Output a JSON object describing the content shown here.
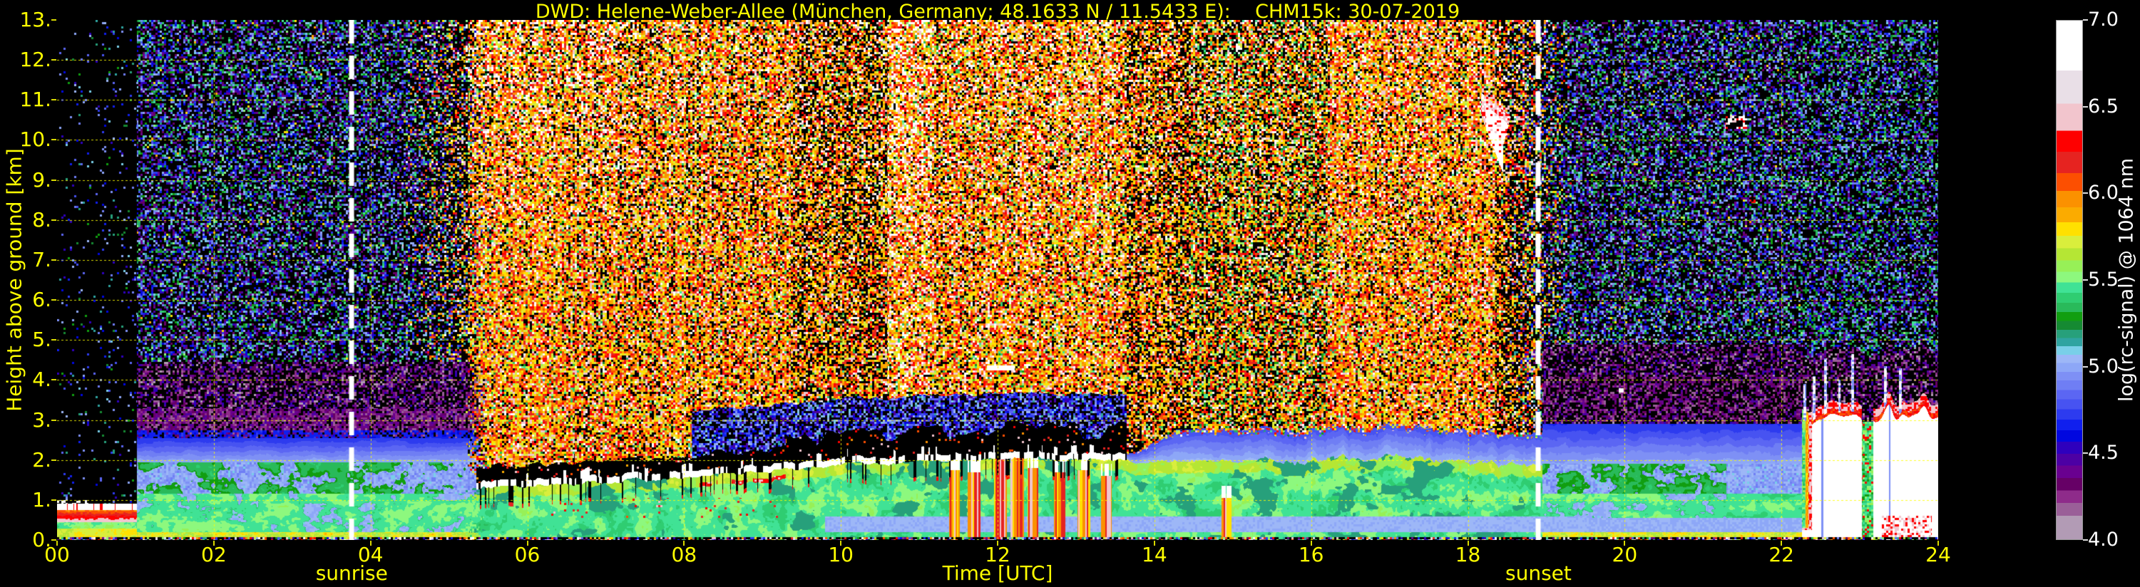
{
  "title": "DWD: Helene-Weber-Allee (München, Germany; 48.1633 N / 11.5433 E):    CHM15k: 30-07-2019",
  "axes": {
    "x": {
      "label": "Time [UTC]",
      "ticks": [
        "00",
        "02",
        "04",
        "06",
        "08",
        "10",
        "12",
        "14",
        "16",
        "18",
        "20",
        "22",
        "24"
      ]
    },
    "y": {
      "label": "Height above ground [km]",
      "ticks": [
        "0.",
        "1.",
        "2.",
        "3.",
        "4.",
        "5.",
        "6.",
        "7.",
        "8.",
        "9.",
        "10.",
        "11.",
        "12.",
        "13."
      ]
    }
  },
  "annotations": {
    "sunrise": {
      "label": "sunrise",
      "hour": 3.76
    },
    "sunset": {
      "label": "sunset",
      "hour": 18.9
    }
  },
  "colors": {
    "background": "#000000",
    "axis_text": "#ffff00",
    "grid": "#ffff00",
    "sun_line": "#ffffff",
    "colorbar_text": "#ffffff"
  },
  "colorbar": {
    "label": "log(rc-signal) @ 1064 nm",
    "ticks": [
      "7.0",
      "6.5",
      "6.0",
      "5.5",
      "5.0",
      "4.5",
      "4.0"
    ],
    "range": [
      4.0,
      7.0
    ],
    "bands": [
      {
        "stop": 0.0,
        "color": "#ffffff"
      },
      {
        "stop": 0.096,
        "color": "#e9dfe7"
      },
      {
        "stop": 0.16,
        "color": "#f2c5cd"
      },
      {
        "stop": 0.212,
        "color": "#fe0000"
      },
      {
        "stop": 0.253,
        "color": "#e62320"
      },
      {
        "stop": 0.294,
        "color": "#fc4f01"
      },
      {
        "stop": 0.328,
        "color": "#fb9100"
      },
      {
        "stop": 0.36,
        "color": "#fbab00"
      },
      {
        "stop": 0.389,
        "color": "#ffe000"
      },
      {
        "stop": 0.415,
        "color": "#d9ee3c"
      },
      {
        "stop": 0.439,
        "color": "#b5e634"
      },
      {
        "stop": 0.462,
        "color": "#97f057"
      },
      {
        "stop": 0.484,
        "color": "#8df87e"
      },
      {
        "stop": 0.505,
        "color": "#40e295"
      },
      {
        "stop": 0.525,
        "color": "#2fcd71"
      },
      {
        "stop": 0.544,
        "color": "#29ba5a"
      },
      {
        "stop": 0.562,
        "color": "#119e10"
      },
      {
        "stop": 0.579,
        "color": "#158a32"
      },
      {
        "stop": 0.596,
        "color": "#27a07b"
      },
      {
        "stop": 0.612,
        "color": "#2fa4a1"
      },
      {
        "stop": 0.628,
        "color": "#79cfe8"
      },
      {
        "stop": 0.644,
        "color": "#9db7f7"
      },
      {
        "stop": 0.66,
        "color": "#8da7f7"
      },
      {
        "stop": 0.677,
        "color": "#7e90f5"
      },
      {
        "stop": 0.694,
        "color": "#6f7ef4"
      },
      {
        "stop": 0.712,
        "color": "#5b66f3"
      },
      {
        "stop": 0.73,
        "color": "#4753f1"
      },
      {
        "stop": 0.749,
        "color": "#2d3bef"
      },
      {
        "stop": 0.769,
        "color": "#101fee"
      },
      {
        "stop": 0.79,
        "color": "#0007e0"
      },
      {
        "stop": 0.812,
        "color": "#2e00bd"
      },
      {
        "stop": 0.835,
        "color": "#4c00a4"
      },
      {
        "stop": 0.858,
        "color": "#690090"
      },
      {
        "stop": 0.882,
        "color": "#660066"
      },
      {
        "stop": 0.906,
        "color": "#8e2b8a"
      },
      {
        "stop": 0.93,
        "color": "#9a5f98"
      },
      {
        "stop": 0.955,
        "color": "#b29bb5"
      }
    ]
  },
  "chart_data": {
    "type": "heatmap",
    "title": "DWD: Helene-Weber-Allee (München, Germany; 48.1633 N / 11.5433 E):    CHM15k: 30-07-2019",
    "x": {
      "label": "Time [UTC]",
      "range_hours": [
        0,
        24
      ],
      "tick_interval_hours": 2
    },
    "y": {
      "label": "Height above ground [km]",
      "range_km": [
        0,
        13
      ],
      "tick_interval_km": 1
    },
    "value": {
      "label": "log(rc-signal) @ 1064 nm",
      "range": [
        4.0,
        7.0
      ],
      "tick_interval": 0.5
    },
    "sunrise_hour": 3.76,
    "sunset_hour": 18.9,
    "boundary_layer_top": {
      "hours": [
        0,
        0.5,
        1,
        2,
        3,
        4,
        5,
        6,
        7,
        8,
        9,
        10,
        11,
        12,
        13,
        14,
        15,
        16,
        17,
        18,
        19,
        20,
        21,
        21.9,
        22.26,
        24
      ],
      "km": [
        0.85,
        0.9,
        1.05,
        1.2,
        1.28,
        1.32,
        1.35,
        1.4,
        1.5,
        1.6,
        1.75,
        1.95,
        2.0,
        2.05,
        2.05,
        1.95,
        1.95,
        2.0,
        2.05,
        1.95,
        1.85,
        1.6,
        1.5,
        1.55,
        1.6,
        1.6
      ]
    },
    "features": {
      "shallow_nocturnal_layer": {
        "hours": [
          0,
          1.0
        ],
        "white_cap_km": [
          0.74,
          0.9
        ],
        "red_layer_km": [
          0.45,
          0.74
        ]
      },
      "predawn_layers": {
        "green_top_km": 1.95,
        "blue_top_km": 2.55,
        "crimson_band_km": [
          2.35,
          3.3
        ],
        "purple_speckle_km": [
          3.3,
          4.45
        ]
      },
      "evening_layers": {
        "green_top_km": 1.9,
        "blue_top_km": 2.9,
        "crimson_band_km": [
          2.95,
          4.1
        ],
        "purple_speckle_km": [
          4.1,
          4.9
        ]
      },
      "morning_cap": {
        "hours": [
          5.35,
          13.65
        ],
        "note": "broken white aerosol top line with black notches"
      },
      "midday_updraft_columns": [
        [
          11.38,
          11.52,
          1.75
        ],
        [
          11.62,
          11.78,
          1.7
        ],
        [
          11.95,
          12.12,
          2.1
        ],
        [
          12.16,
          12.34,
          2.15
        ],
        [
          12.38,
          12.52,
          1.8
        ],
        [
          12.72,
          12.86,
          1.7
        ],
        [
          13.02,
          13.18,
          1.75
        ],
        [
          13.32,
          13.46,
          1.6
        ],
        [
          14.86,
          14.98,
          1.05
        ]
      ],
      "pale_underlayer": {
        "hours": [
          9.8,
          19.5
        ],
        "km": [
          0.2,
          0.58
        ]
      },
      "contrail": {
        "hours": [
          11.86,
          12.22
        ],
        "km": 4.3
      },
      "cirrus_cloud": {
        "hours": [
          18.17,
          18.73
        ],
        "km_top": 11.2,
        "km_bottom": 9.8
      },
      "small_cirrus": {
        "hours": [
          21.28,
          21.56
        ],
        "km": [
          10.27,
          10.62
        ]
      },
      "small_spot_8km": {
        "hours": [
          21.6,
          21.67
        ],
        "km": [
          8.42,
          8.58
        ]
      },
      "small_spot_4km": {
        "hours": [
          19.92,
          19.99
        ],
        "km": [
          3.68,
          3.79
        ]
      },
      "evening_precipitation": {
        "hours": [
          22.26,
          24.0
        ],
        "mound_hours": [
          21.88,
          22.26
        ],
        "top_km_base": 3.02,
        "gap_hours": [
          23.03,
          23.17
        ],
        "ground_red_hours": [
          23.28,
          23.92
        ],
        "spikes": [
          [
            22.3,
            3.9
          ],
          [
            22.42,
            4.1
          ],
          [
            22.56,
            4.55
          ],
          [
            22.74,
            4.0
          ],
          [
            22.91,
            4.65
          ],
          [
            23.33,
            4.35
          ],
          [
            23.52,
            4.3
          ]
        ]
      }
    },
    "noise_brightness_segments": [
      [
        0,
        4,
        1.0
      ],
      [
        4,
        5.25,
        0.6
      ],
      [
        5.25,
        6.6,
        1.12
      ],
      [
        6.6,
        9.35,
        1.0
      ],
      [
        9.35,
        10.6,
        0.8
      ],
      [
        10.6,
        11.15,
        1.25
      ],
      [
        11.15,
        13.65,
        1.05
      ],
      [
        13.65,
        14.45,
        0.78
      ],
      [
        14.45,
        16.2,
        0.85
      ],
      [
        16.2,
        18.35,
        1.0
      ],
      [
        18.35,
        24,
        0.7
      ]
    ]
  }
}
